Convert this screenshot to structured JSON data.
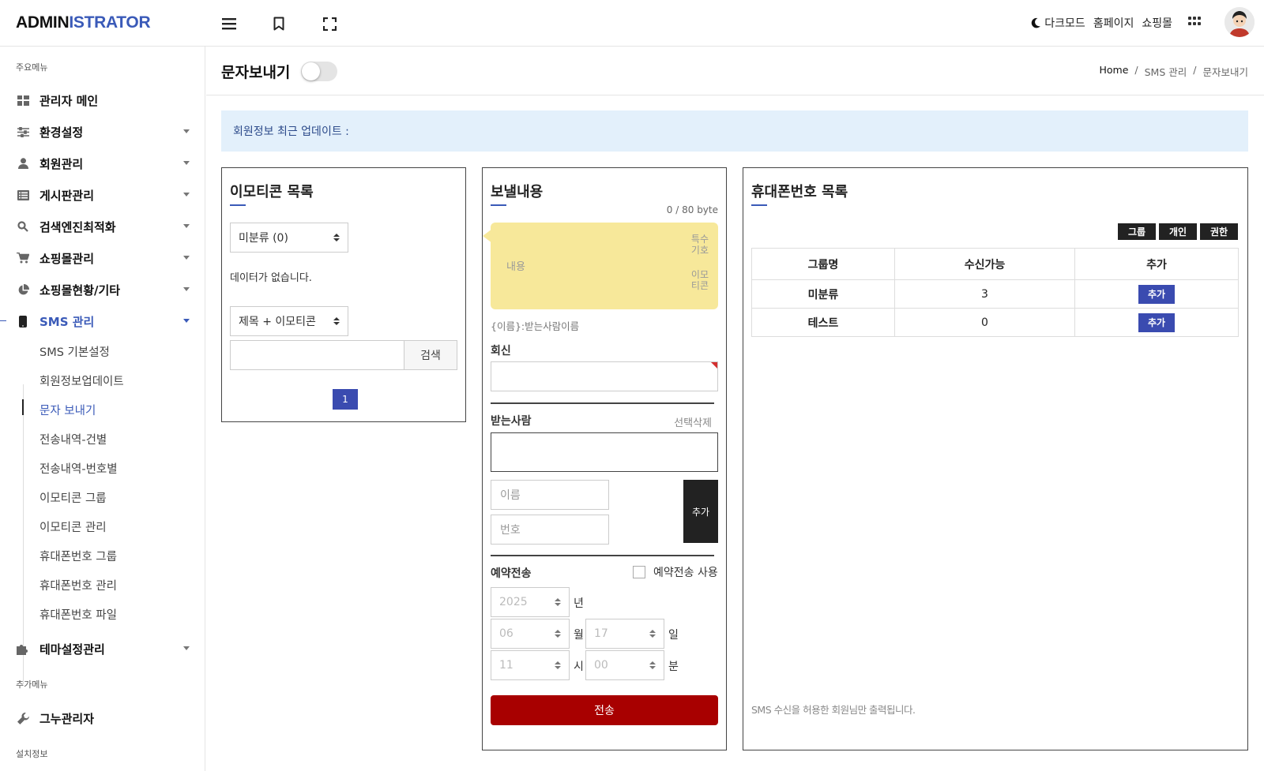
{
  "app": {
    "logo_a": "ADMIN",
    "logo_b": "ISTRATOR"
  },
  "topbar": {
    "darkmode": "다크모드",
    "homepage": "홈페이지",
    "shop": "쇼핑몰"
  },
  "sidebar": {
    "section_main": "주요메뉴",
    "items": [
      {
        "label": "관리자 메인",
        "icon": "dashboard-icon"
      },
      {
        "label": "환경설정",
        "icon": "settings-sliders-icon"
      },
      {
        "label": "회원관리",
        "icon": "user-icon"
      },
      {
        "label": "게시판관리",
        "icon": "list-icon"
      },
      {
        "label": "검색엔진최적화",
        "icon": "search-icon"
      },
      {
        "label": "쇼핑몰관리",
        "icon": "cart-icon"
      },
      {
        "label": "쇼핑몰현황/기타",
        "icon": "pie-chart-icon"
      },
      {
        "label": "SMS 관리",
        "icon": "mobile-icon"
      }
    ],
    "sub_items": [
      "SMS 기본설정",
      "회원정보업데이트",
      "문자 보내기",
      "전송내역-건별",
      "전송내역-번호별",
      "이모티콘 그룹",
      "이모티콘 관리",
      "휴대폰번호 그룹",
      "휴대폰번호 관리",
      "휴대폰번호 파일"
    ],
    "theme": "테마설정관리",
    "section_extra": "추가메뉴",
    "gnu": "그누관리자",
    "section_install": "설치정보"
  },
  "page": {
    "title": "문자보내기"
  },
  "breadcrumb": {
    "home": "Home",
    "sep": "/",
    "level1": "SMS 관리",
    "level2": "문자보내기"
  },
  "notice": "회원정보 최근 업데이트 :",
  "emoticon": {
    "title": "이모티콘 목록",
    "group_select": "미분류 (0)",
    "empty": "데이터가 없습니다.",
    "search_type": "제목 + 이모티콘",
    "search_value": "",
    "search_button": "검색",
    "page": "1"
  },
  "send": {
    "title": "보낼내용",
    "byte_count": "0 / 80 byte",
    "content_placeholder": "내용",
    "special_chars_1": "특수",
    "special_chars_2": "기호",
    "emoticon_1": "이모",
    "emoticon_2": "티콘",
    "name_hint": "{이름}:받는사람이름",
    "reply_label": "회신",
    "reply_value": "",
    "recipient_label": "받는사람",
    "delete_selected": "선택삭제",
    "name_placeholder": "이름",
    "number_placeholder": "번호",
    "add_button": "추가",
    "reserve_label": "예약전송",
    "reserve_use": "예약전송 사용",
    "year": "2025",
    "year_unit": "년",
    "month": "06",
    "month_unit": "월",
    "day": "17",
    "day_unit": "일",
    "hour": "11",
    "hour_unit": "시",
    "minute": "00",
    "minute_unit": "분",
    "send_button": "전송"
  },
  "phone": {
    "title": "휴대폰번호 목록",
    "buttons": [
      "그룹",
      "개인",
      "권한"
    ],
    "columns": [
      "그룹명",
      "수신가능",
      "추가"
    ],
    "rows": [
      {
        "name": "미분류",
        "count": "3",
        "action": "추가"
      },
      {
        "name": "테스트",
        "count": "0",
        "action": "추가"
      }
    ],
    "footnote": "SMS 수신을 허용한 회원님만 출력됩니다."
  },
  "colors": {
    "accent": "#3a5ab8",
    "send_button": "#a80000",
    "sms_bubble": "#f7e89a",
    "notice_bg": "#e3f0fb"
  }
}
